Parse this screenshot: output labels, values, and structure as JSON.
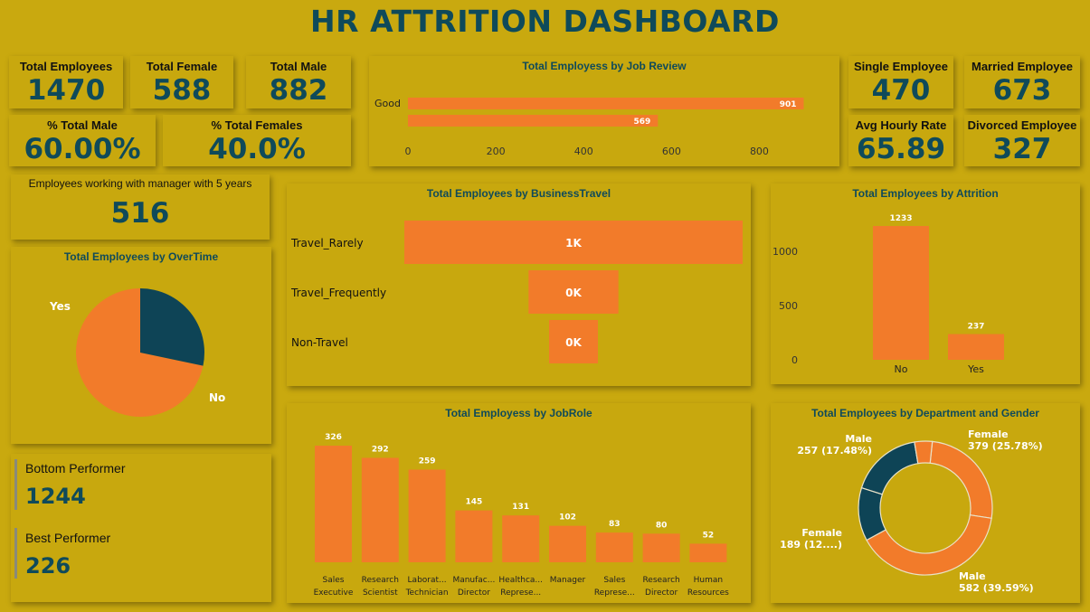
{
  "header": {
    "title": "HR ATTRITION DASHBOARD"
  },
  "colors": {
    "background": "#C9A90F",
    "accent_orange": "#F27B2A",
    "dark_teal": "#0F4A5A"
  },
  "kpis": {
    "total_employees": {
      "label": "Total Employees",
      "value": "1470"
    },
    "total_female": {
      "label": "Total Female",
      "value": "588"
    },
    "total_male": {
      "label": "Total Male",
      "value": "882"
    },
    "pct_male": {
      "label": "% Total Male",
      "value": "60.00%"
    },
    "pct_female": {
      "label": "% Total Females",
      "value": "40.0%"
    },
    "single": {
      "label": "Single Employee",
      "value": "470"
    },
    "married": {
      "label": "Married Employee",
      "value": "673"
    },
    "hourly": {
      "label": "Avg Hourly Rate",
      "value": "65.89"
    },
    "divorced": {
      "label": "Divorced Employee",
      "value": "327"
    },
    "manager": {
      "label": "Employees working with manager with 5 years",
      "value": "516"
    }
  },
  "performers": {
    "bottom": {
      "label": "Bottom Performer",
      "value": "1244"
    },
    "best": {
      "label": "Best Performer",
      "value": "226"
    }
  },
  "charts": {
    "job_review": {
      "title": "Total Employess by Job Review",
      "type": "bar",
      "orientation": "horizontal",
      "categories": [
        "Good",
        ""
      ],
      "values": [
        901,
        569
      ],
      "value_labels": [
        "901",
        "569"
      ],
      "xlim": [
        0,
        900
      ],
      "ticks": [
        "0",
        "200",
        "400",
        "600",
        "800"
      ],
      "tick_values": [
        0,
        200,
        400,
        600,
        800
      ]
    },
    "business_travel": {
      "title": "Total Employees by BusinessTravel",
      "type": "bar",
      "orientation": "funnel",
      "categories": [
        "Travel_Rarely",
        "Travel_Frequently",
        "Non-Travel"
      ],
      "values": [
        1043,
        277,
        150
      ],
      "value_labels": [
        "1K",
        "0K",
        "0K"
      ]
    },
    "attrition": {
      "title": "Total Employees by Attrition",
      "type": "bar",
      "categories": [
        "No",
        "Yes"
      ],
      "values": [
        1233,
        237
      ],
      "value_labels": [
        "1233",
        "237"
      ],
      "ylim": [
        0,
        1233
      ],
      "ticks": [
        "1000",
        "500",
        "0"
      ],
      "tick_values": [
        1000,
        500,
        0
      ]
    },
    "overtime": {
      "title": "Total Employees by OverTime",
      "type": "pie",
      "labels": [
        "No",
        "Yes"
      ],
      "values": [
        1054,
        416
      ],
      "colors": [
        "#F27B2A",
        "#0E4456"
      ]
    },
    "job_role": {
      "title": "Total Employess by JobRole",
      "type": "bar",
      "categories": [
        [
          "Sales",
          "Executive"
        ],
        [
          "Research",
          "Scientist"
        ],
        [
          "Laborat...",
          "Technician"
        ],
        [
          "Manufac...",
          "Director"
        ],
        [
          "Healthca...",
          "Represe..."
        ],
        [
          "Manager",
          ""
        ],
        [
          "Sales",
          "Represe..."
        ],
        [
          "Research",
          "Director"
        ],
        [
          "Human",
          "Resources"
        ]
      ],
      "values": [
        326,
        292,
        259,
        145,
        131,
        102,
        83,
        80,
        52
      ],
      "value_labels": [
        "326",
        "292",
        "259",
        "145",
        "131",
        "102",
        "83",
        "80",
        "52"
      ]
    },
    "dept_gender": {
      "title": "Total Employees by Department and Gender",
      "type": "pie",
      "variant": "donut",
      "segments": [
        {
          "label1": "Female",
          "label2": "379 (25.78%)",
          "value": 379,
          "color": "#F27B2A"
        },
        {
          "label1": "Male",
          "label2": "582 (39.59%)",
          "value": 582,
          "color": "#F27B2A"
        },
        {
          "label1": "Female",
          "label2": "189 (12....)",
          "value": 189,
          "color": "#0E4456"
        },
        {
          "label1": "Male",
          "label2": "257 (17.48%)",
          "value": 257,
          "color": "#0E4456"
        },
        {
          "label1": "",
          "label2": "",
          "value": 63,
          "color": "#F27B2A"
        }
      ]
    }
  }
}
